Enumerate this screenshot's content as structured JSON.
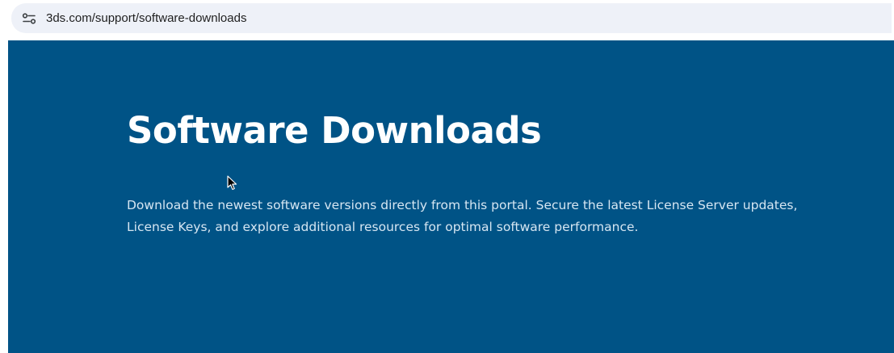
{
  "browser": {
    "url": "3ds.com/support/software-downloads",
    "site_info_icon": "tune-icon"
  },
  "hero": {
    "title": "Software Downloads",
    "description": "Download the newest software versions directly from this portal. Secure the latest License Server updates, License Keys, and explore additional resources for optimal software performance.",
    "background_color": "#005386",
    "text_color": "#ffffff"
  },
  "cursor": {
    "icon": "mouse-pointer-icon"
  }
}
